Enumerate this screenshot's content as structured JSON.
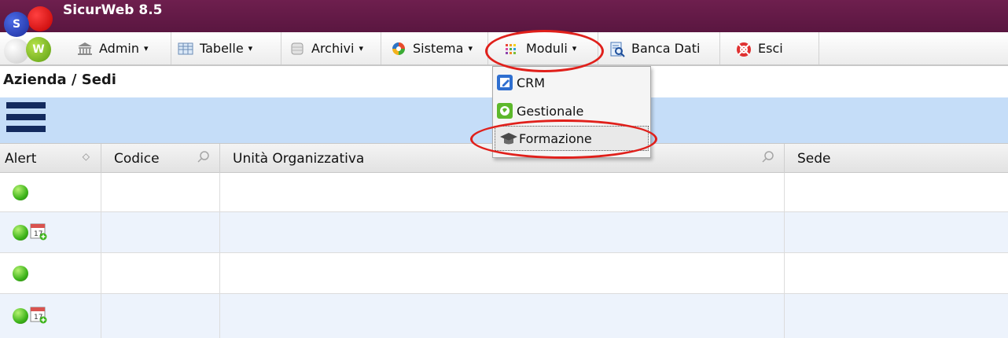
{
  "app": {
    "title": "SicurWeb 8.5",
    "logo_letters": [
      "S",
      "W"
    ]
  },
  "menu": {
    "items": [
      {
        "key": "admin",
        "label": "Admin",
        "icon": "building-icon",
        "has_caret": true
      },
      {
        "key": "tabelle",
        "label": "Tabelle",
        "icon": "table-icon",
        "has_caret": true
      },
      {
        "key": "archivi",
        "label": "Archivi",
        "icon": "database-icon",
        "has_caret": true
      },
      {
        "key": "sistema",
        "label": "Sistema",
        "icon": "system-icon",
        "has_caret": true
      },
      {
        "key": "moduli",
        "label": "Moduli",
        "icon": "modules-grid-icon",
        "has_caret": true
      },
      {
        "key": "banca_dati",
        "label": "Banca Dati",
        "icon": "search-document-icon",
        "has_caret": false
      },
      {
        "key": "esci",
        "label": "Esci",
        "icon": "exit-icon",
        "has_caret": false
      }
    ],
    "caret": "▾"
  },
  "moduli_dropdown": {
    "items": [
      {
        "label": "CRM",
        "icon": "edit-icon"
      },
      {
        "label": "Gestionale",
        "icon": "globe-icon"
      },
      {
        "label": "Formazione",
        "icon": "graduation-cap-icon",
        "active": true
      }
    ]
  },
  "breadcrumb": "Azienda / Sedi",
  "table": {
    "headers": [
      "Alert",
      "Codice",
      "Unità Organizzativa",
      "Sede"
    ],
    "rows": [
      {
        "status": "green",
        "calendar": false
      },
      {
        "status": "green",
        "calendar": true
      },
      {
        "status": "green",
        "calendar": false
      },
      {
        "status": "green",
        "calendar": true
      }
    ]
  },
  "calendar_day": "17",
  "colors": {
    "titlebar": "#5a1640",
    "toolbar_band": "#c5ddf8",
    "row_alt": "#edf3fc",
    "highlight": "#e0201b",
    "status_green": "#3eb41b"
  }
}
